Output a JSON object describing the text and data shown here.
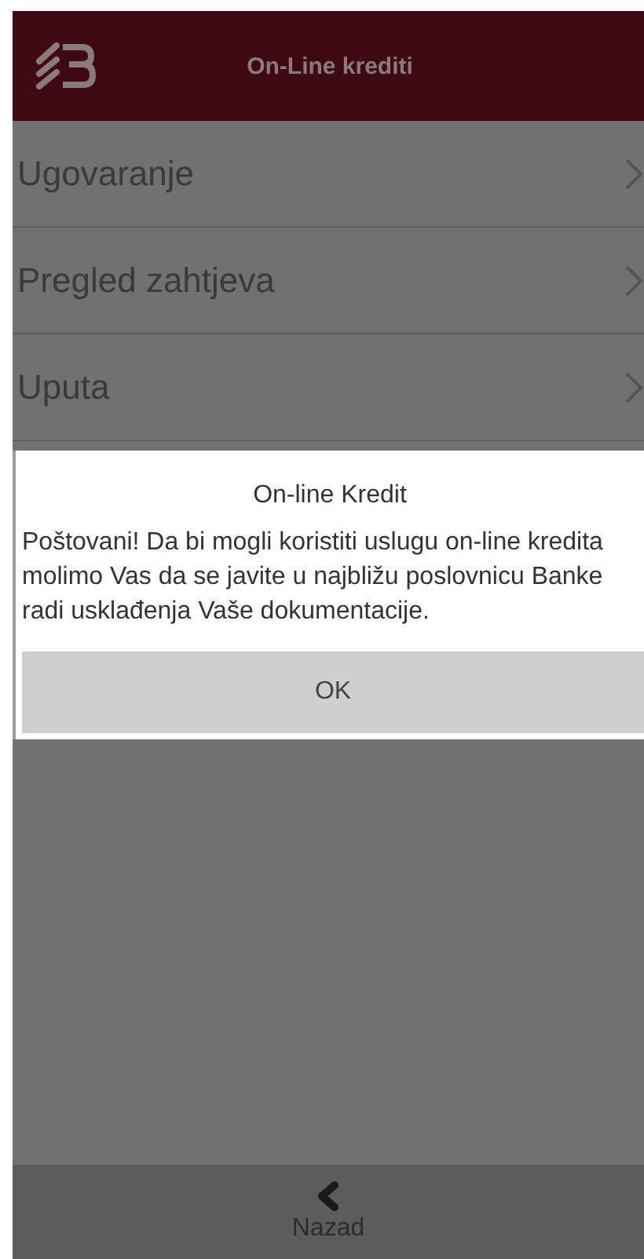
{
  "header": {
    "title": "On-Line krediti"
  },
  "menu": [
    {
      "label": "Ugovaranje"
    },
    {
      "label": "Pregled zahtjeva"
    },
    {
      "label": "Uputa"
    }
  ],
  "dialog": {
    "title": "On-line Kredit",
    "message": "Poštovani! Da bi mogli koristiti uslugu on-line kredita molimo Vas da se javite u najbližu poslovnicu Banke radi usklađenja Vaše dokumentacije.",
    "button": "OK"
  },
  "bottom_bar": {
    "back_label": "Nazad"
  }
}
